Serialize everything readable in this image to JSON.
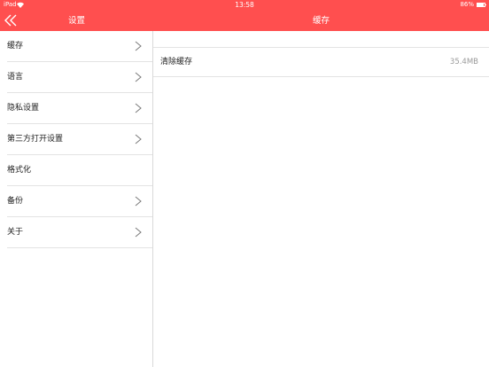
{
  "status_bar": {
    "device": "iPad",
    "time": "13:58",
    "battery": "86%"
  },
  "nav": {
    "left_title": "设置",
    "right_title": "缓存",
    "back_icon": "double-chevron-left-icon"
  },
  "sidebar": {
    "items": [
      {
        "label": "缓存",
        "has_chevron": true
      },
      {
        "label": "语言",
        "has_chevron": true
      },
      {
        "label": "隐私设置",
        "has_chevron": true
      },
      {
        "label": "第三方打开设置",
        "has_chevron": true
      },
      {
        "label": "格式化",
        "has_chevron": false
      },
      {
        "label": "备份",
        "has_chevron": true
      },
      {
        "label": "关于",
        "has_chevron": true
      }
    ]
  },
  "content": {
    "cache_row": {
      "label": "清除缓存",
      "value": "35.4MB"
    }
  },
  "colors": {
    "accent": "#ff4f4f",
    "divider": "#e3e3e3",
    "secondary_text": "#9a9a9a"
  }
}
